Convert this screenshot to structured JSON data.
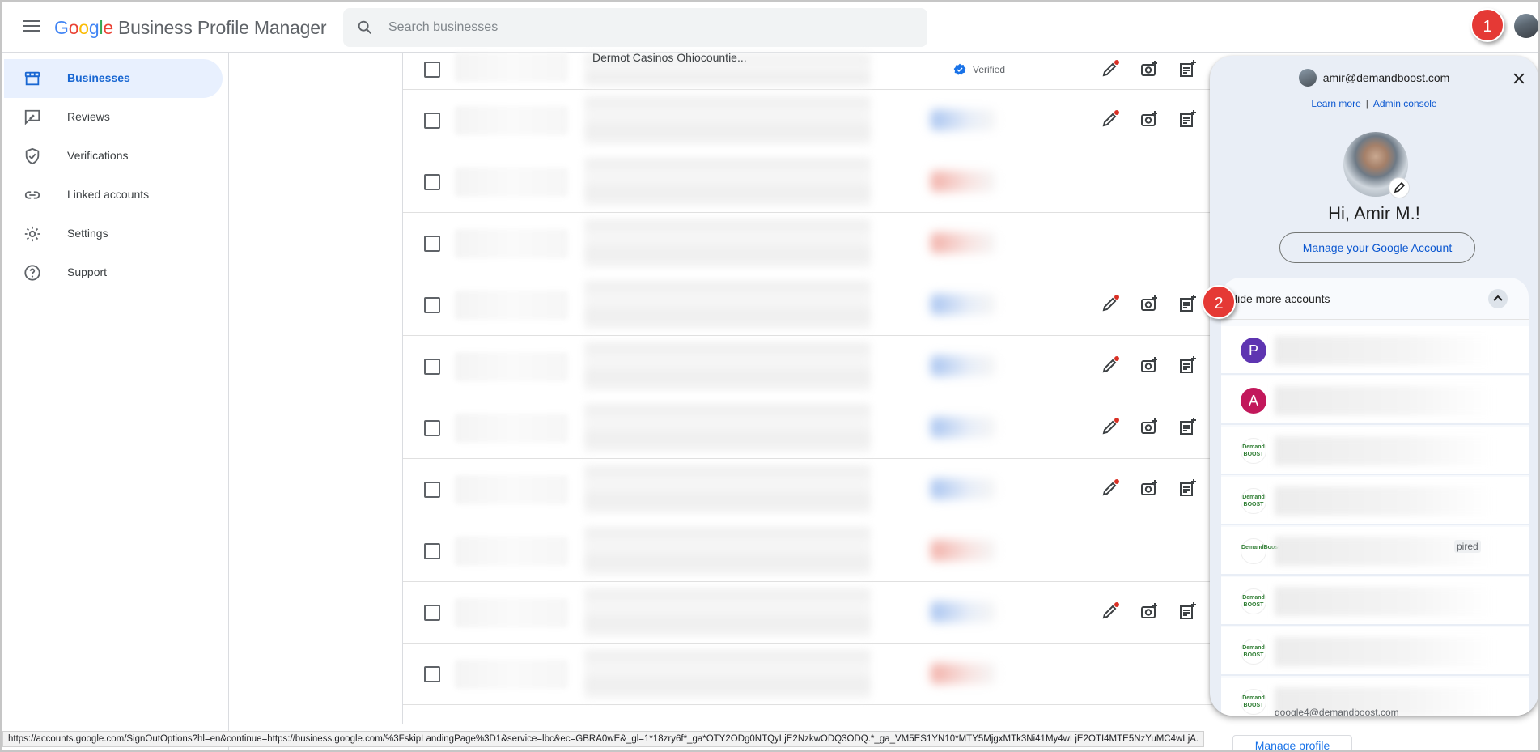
{
  "header": {
    "logo_google": [
      "G",
      "o",
      "o",
      "g",
      "l",
      "e"
    ],
    "logo_rest": "Business Profile Manager",
    "search_placeholder": "Search businesses"
  },
  "sidebar": {
    "items": [
      {
        "label": "Businesses",
        "icon": "storefront-icon",
        "active": true
      },
      {
        "label": "Reviews",
        "icon": "rate-review-icon",
        "active": false
      },
      {
        "label": "Verifications",
        "icon": "verified-shield-icon",
        "active": false
      },
      {
        "label": "Linked accounts",
        "icon": "link-icon",
        "active": false
      },
      {
        "label": "Settings",
        "icon": "gear-icon",
        "active": false
      },
      {
        "label": "Support",
        "icon": "help-icon",
        "active": false
      }
    ]
  },
  "table": {
    "first_row_partial_name": "Dermot Casinos Ohiocountie...",
    "first_row_status": "Verified",
    "rows": [
      {
        "status": "verified",
        "actions": true
      },
      {
        "status": "blue",
        "actions": true
      },
      {
        "status": "red",
        "actions": false
      },
      {
        "status": "red",
        "actions": false
      },
      {
        "status": "blue",
        "actions": true
      },
      {
        "status": "blue",
        "actions": true
      },
      {
        "status": "blue",
        "actions": true
      },
      {
        "status": "blue",
        "actions": true
      },
      {
        "status": "red",
        "actions": false
      },
      {
        "status": "blue",
        "actions": true
      },
      {
        "status": "red",
        "actions": false
      }
    ]
  },
  "account_popup": {
    "email": "amir@demandboost.com",
    "learn_more": "Learn more",
    "separator": "|",
    "admin_console": "Admin console",
    "greeting": "Hi, Amir M.!",
    "manage_account": "Manage your Google Account",
    "more_accounts_toggle": "Hide more accounts",
    "accounts": [
      {
        "initial": "P",
        "color": "#5e35b1",
        "type": "letter"
      },
      {
        "initial": "A",
        "color": "#c2185b",
        "type": "letter"
      },
      {
        "logo_text": "Demand BOOST",
        "type": "logo"
      },
      {
        "logo_text": "Demand BOOST",
        "type": "logo"
      },
      {
        "logo_text": "DemandBoost",
        "type": "logo",
        "tail": "pired"
      },
      {
        "logo_text": "Demand BOOST",
        "type": "logo"
      },
      {
        "logo_text": "Demand BOOST",
        "type": "logo"
      },
      {
        "logo_text": "Demand BOOST",
        "type": "logo"
      }
    ],
    "last_email": "google4@demandboost.com"
  },
  "annotations": {
    "badge_1": "1",
    "badge_2": "2",
    "badge_color": "#e53935"
  },
  "status_bar": {
    "url": "https://accounts.google.com/SignOutOptions?hl=en&continue=https://business.google.com/%3FskipLandingPage%3D1&service=lbc&ec=GBRA0wE&_gl=1*18zry6f*_ga*OTY2ODg0NTQyLjE2NzkwODQ3ODQ.*_ga_VM5ES1YN10*MTY5MjgxMTk3Ni41My4wLjE2OTI4MTE5NzYuMC4wLjA."
  },
  "peek": {
    "manage_profile": "Manage profile"
  }
}
